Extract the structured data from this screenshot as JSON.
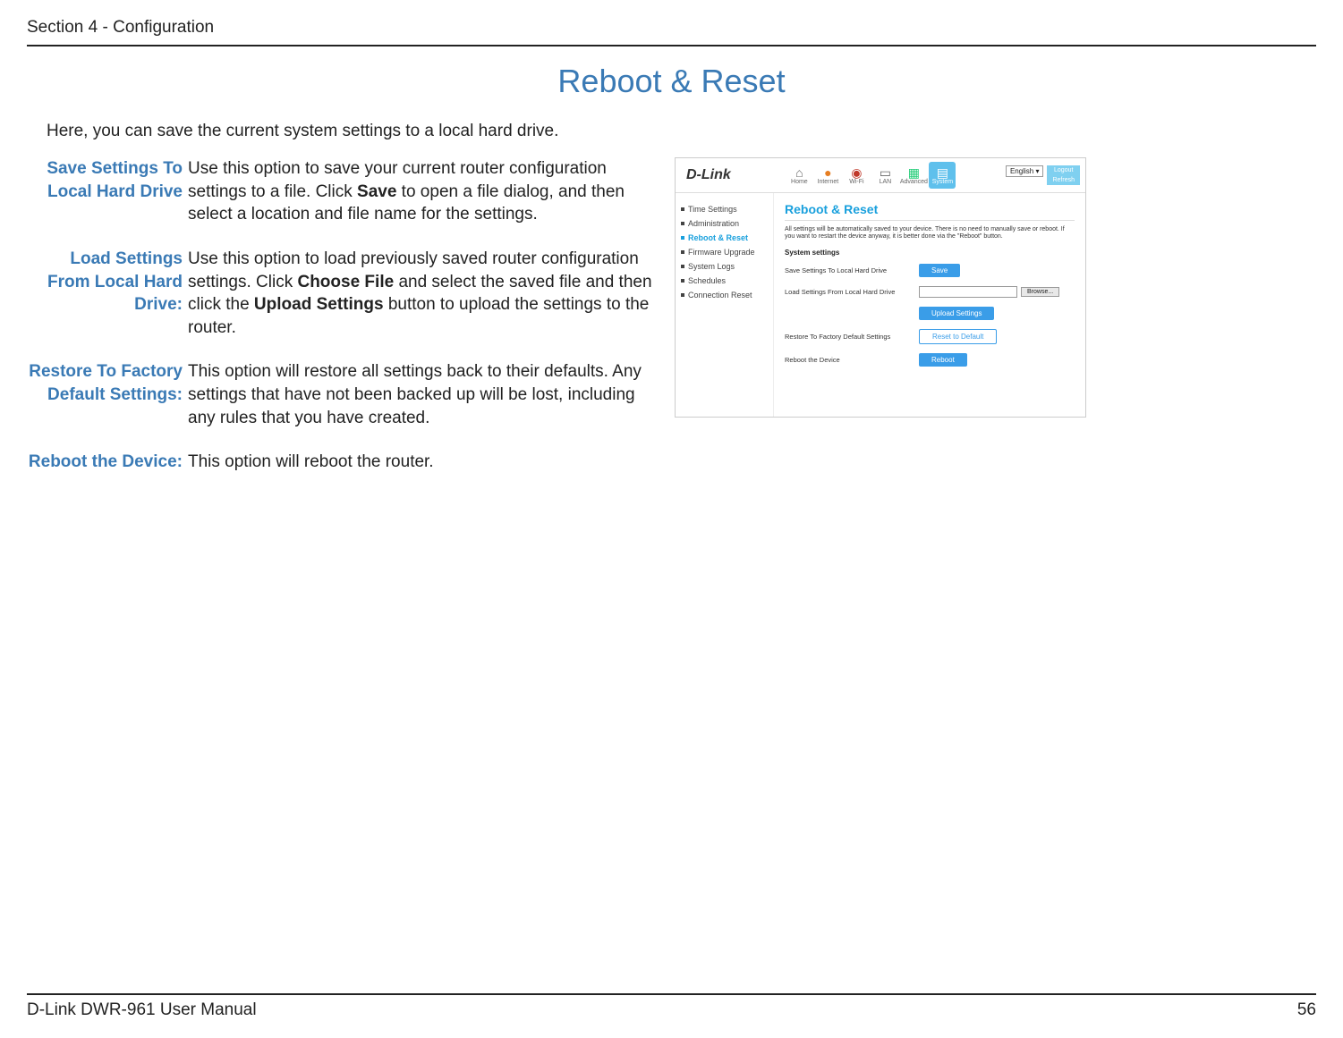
{
  "header": {
    "section": "Section 4 - Configuration"
  },
  "page": {
    "title": "Reboot & Reset",
    "intro": "Here, you can save the current system settings to a local hard drive."
  },
  "definitions": [
    {
      "term": "Save Settings To Local Hard Drive",
      "desc_pre": "Use this option to save your current router configuration settings to a file. Click ",
      "bold1": "Save",
      "desc_post": " to open a file dialog, and then select a location and file name for the settings."
    },
    {
      "term": "Load Settings From Local Hard Drive:",
      "desc_pre": "Use this option to load previously saved router configuration settings. Click ",
      "bold1": "Choose File",
      "desc_mid": " and select the saved file and then click the ",
      "bold2": "Upload Settings",
      "desc_post": " button to upload the settings to the router."
    },
    {
      "term": "Restore To Factory Default Settings:",
      "desc_pre": "This option will restore all settings back to their defaults. Any settings that have not been backed up will be lost, including any rules that you have created."
    },
    {
      "term": "Reboot the Device:",
      "desc_pre": "This option will reboot the router."
    }
  ],
  "screenshot": {
    "logo": "D-Link",
    "nav": [
      {
        "label": "Home",
        "icon": "⌂"
      },
      {
        "label": "Internet",
        "icon": "●"
      },
      {
        "label": "Wi-Fi",
        "icon": "◉"
      },
      {
        "label": "LAN",
        "icon": "▭"
      },
      {
        "label": "Advanced",
        "icon": "▦"
      },
      {
        "label": "System",
        "icon": "▤"
      }
    ],
    "lang": "English",
    "lang_icon": "▾",
    "side_buttons": {
      "logout": "Logout",
      "refresh": "Refresh"
    },
    "sidebar": [
      "Time Settings",
      "Administration",
      "Reboot & Reset",
      "Firmware Upgrade",
      "System Logs",
      "Schedules",
      "Connection Reset"
    ],
    "sidebar_active_index": 2,
    "panel_title": "Reboot & Reset",
    "help_text": "All settings will be automatically saved to your device. There is no need to manually save or reboot. If you want to restart the device anyway, it is better done via the \"Reboot\" button.",
    "section_label": "System settings",
    "rows": {
      "save": {
        "label": "Save Settings To Local Hard Drive",
        "button": "Save"
      },
      "load": {
        "label": "Load Settings From Local Hard Drive",
        "button": "Upload Settings",
        "browse": "Browse..."
      },
      "restore": {
        "label": "Restore To Factory Default Settings",
        "button": "Reset to Default"
      },
      "reboot": {
        "label": "Reboot the Device",
        "button": "Reboot"
      }
    }
  },
  "footer": {
    "left": "D-Link DWR-961 User Manual",
    "right": "56"
  }
}
